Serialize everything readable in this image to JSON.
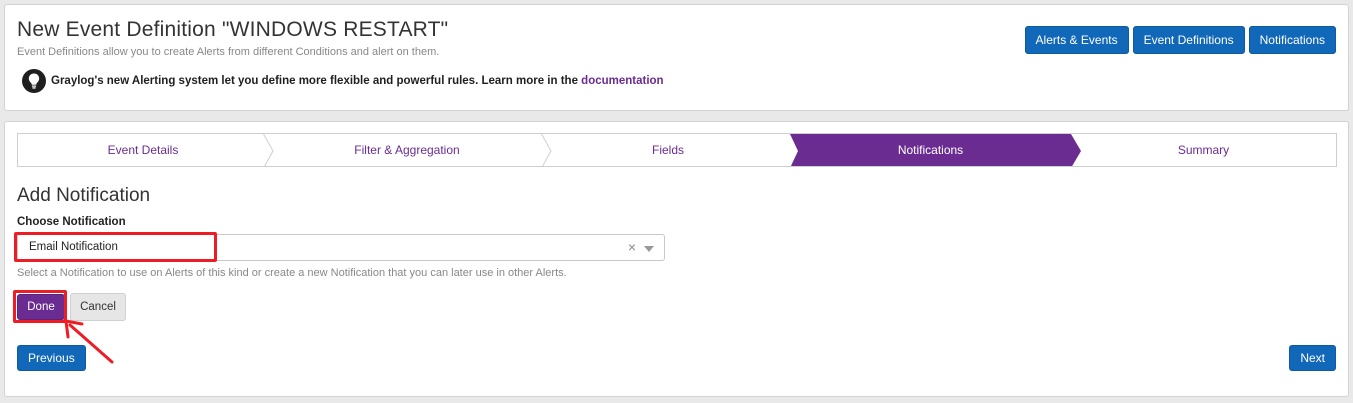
{
  "header": {
    "title": "New Event Definition \"WINDOWS RESTART\"",
    "subtitle": "Event Definitions allow you to create Alerts from different Conditions and alert on them.",
    "notice_text": "Graylog's new Alerting system let you define more flexible and powerful rules. Learn more in the ",
    "notice_link": "documentation",
    "buttons": {
      "alerts_events": "Alerts & Events",
      "event_definitions": "Event Definitions",
      "notifications": "Notifications"
    }
  },
  "wizard": {
    "steps": [
      {
        "label": "Event Details",
        "active": false
      },
      {
        "label": "Filter & Aggregation",
        "active": false
      },
      {
        "label": "Fields",
        "active": false
      },
      {
        "label": "Notifications",
        "active": true
      },
      {
        "label": "Summary",
        "active": false
      }
    ]
  },
  "form": {
    "section_title": "Add Notification",
    "field_label": "Choose Notification",
    "selected_value": "Email Notification",
    "clear_glyph": "×",
    "help_text": "Select a Notification to use on Alerts of this kind or create a new Notification that you can later use in other Alerts.",
    "done_label": "Done",
    "cancel_label": "Cancel"
  },
  "nav": {
    "previous_label": "Previous",
    "next_label": "Next"
  },
  "colors": {
    "primary_blue": "#1268b8",
    "purple": "#6a2c91",
    "annotation_red": "#ee1c25"
  }
}
